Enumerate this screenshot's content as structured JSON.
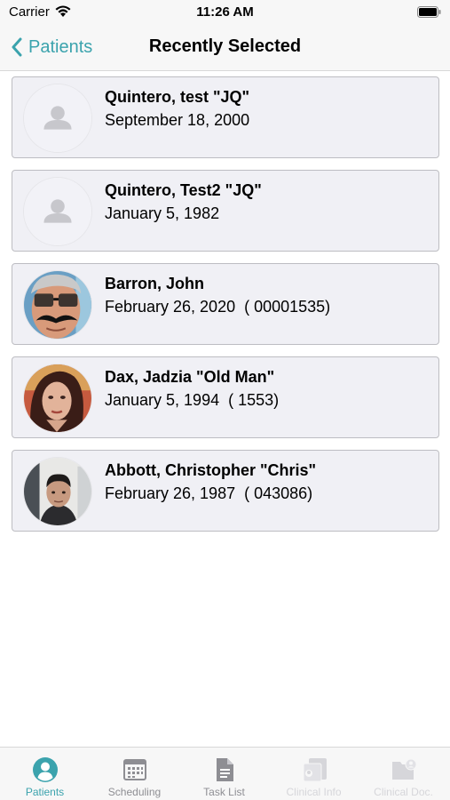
{
  "status_bar": {
    "carrier": "Carrier",
    "time": "11:26 AM"
  },
  "nav": {
    "back_label": "Patients",
    "title": "Recently Selected"
  },
  "patients": [
    {
      "name": "Quintero, test \"JQ\"",
      "details": "September 18, 2000",
      "photo": "placeholder-person-icon"
    },
    {
      "name": "Quintero, Test2 \"JQ\"",
      "details": "January 5, 1982",
      "photo": "placeholder-person-icon"
    },
    {
      "name": "Barron, John",
      "details": "February 26, 2020  ( 00001535)",
      "photo": "man-glasses-mustache-photo"
    },
    {
      "name": "Dax, Jadzia \"Old Man\"",
      "details": "January 5, 1994  ( 1553)",
      "photo": "woman-dark-hair-photo"
    },
    {
      "name": "Abbott, Christopher \"Chris\"",
      "details": "February 26, 1987  ( 043086)",
      "photo": "man-selfie-photo"
    }
  ],
  "tabs": [
    {
      "label": "Patients",
      "icon": "person-circle-icon",
      "state": "active"
    },
    {
      "label": "Scheduling",
      "icon": "calendar-icon",
      "state": "normal"
    },
    {
      "label": "Task List",
      "icon": "document-icon",
      "state": "normal"
    },
    {
      "label": "Clinical Info",
      "icon": "clinical-info-icon",
      "state": "disabled"
    },
    {
      "label": "Clinical Doc.",
      "icon": "folder-person-icon",
      "state": "disabled"
    }
  ],
  "colors": {
    "accent": "#3ba3ad",
    "card_bg": "#f0f0f5",
    "card_border": "#bdbdc2",
    "tab_inactive": "#8e8e93",
    "tab_disabled": "#d6d6da"
  }
}
